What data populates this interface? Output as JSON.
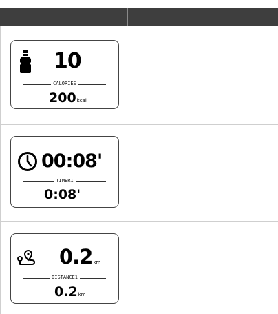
{
  "rows": [
    {
      "label": "CALORIES",
      "big_value": "10",
      "small_value": "200",
      "small_unit": "kcal",
      "icon": "bottle-icon"
    },
    {
      "label": "TIMER1",
      "big_value": "00:08'",
      "small_value": "0:08'",
      "icon": "clock-icon"
    },
    {
      "label": "DISTANCE1",
      "big_value": "0.2",
      "big_unit": "km",
      "small_value": "0.2",
      "small_unit": "km",
      "icon": "route-icon"
    }
  ]
}
